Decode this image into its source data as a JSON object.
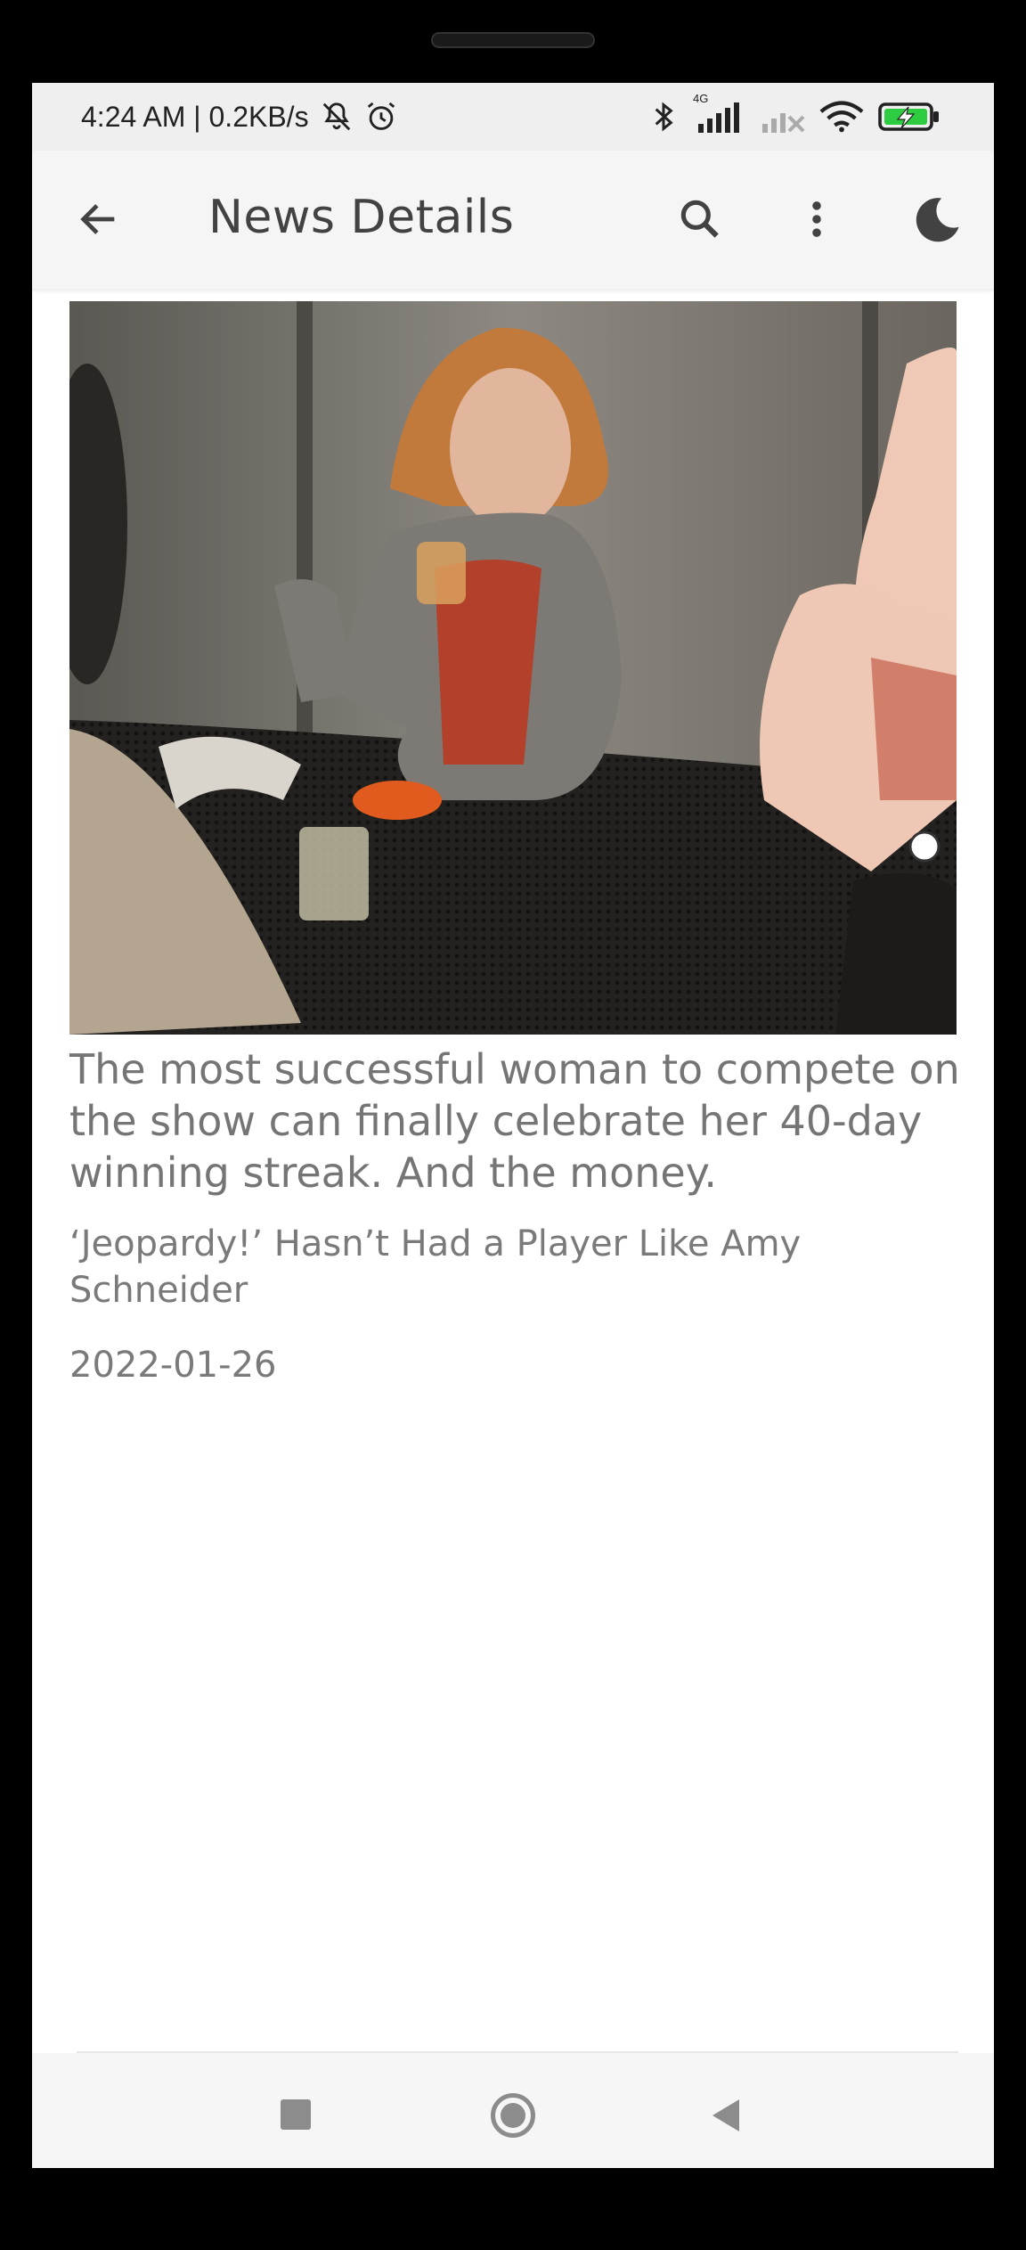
{
  "status_bar": {
    "time_speed": "4:24 AM | 0.2KB/s",
    "network_label": "4G",
    "icons": [
      "mute-bell-icon",
      "alarm-icon",
      "bluetooth-icon",
      "signal-icon",
      "signal-no-sim-icon",
      "wifi-icon",
      "battery-charging-icon"
    ],
    "battery_color": "#2ecc40"
  },
  "app_bar": {
    "title": "News Details",
    "icons": [
      "back-arrow-icon",
      "search-icon",
      "more-vert-icon",
      "dark-mode-moon-icon"
    ]
  },
  "article": {
    "image_description_icon": "article-photo",
    "headline": "The most successful woman to compete on the show can finally celebrate her 40-day winning streak. And the money.",
    "title": "‘Jeopardy!’ Hasn’t Had a Player Like Amy Schneider",
    "date": "2022-01-26"
  },
  "nav_bar": {
    "icons": [
      "recents-square-icon",
      "home-circle-icon",
      "back-triangle-icon"
    ]
  },
  "colors": {
    "app_bar_bg": "#f5f5f5",
    "text_gray": "#757575",
    "title_dark": "#424242"
  }
}
